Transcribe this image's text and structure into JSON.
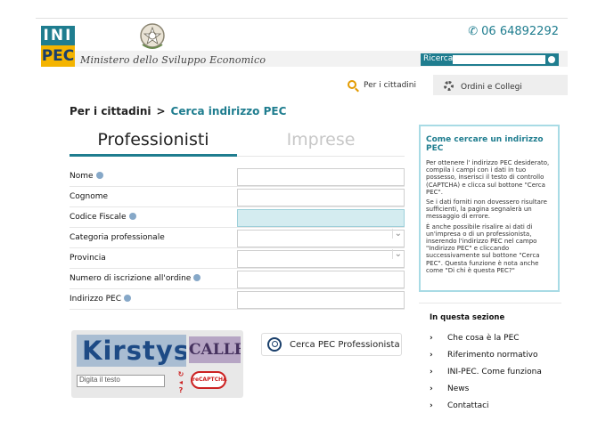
{
  "header": {
    "logo_top": "INI",
    "logo_bottom": "PEC",
    "ministry": "Ministero dello Sviluppo Economico",
    "phone": "06 64892292",
    "search_label": "Ricerca",
    "search_placeholder": ""
  },
  "nav": {
    "citizens": "Per i cittadini",
    "orders": "Ordini e Collegi"
  },
  "breadcrumb": {
    "root": "Per i cittadini",
    "sep": ">",
    "current": "Cerca indirizzo PEC"
  },
  "tabs": [
    "Professionisti",
    "Imprese"
  ],
  "form": {
    "fields": [
      {
        "label": "Nome",
        "info": true,
        "type": "text",
        "value": ""
      },
      {
        "label": "Cognome",
        "info": false,
        "type": "text",
        "value": ""
      },
      {
        "label": "Codice Fiscale",
        "info": true,
        "type": "text",
        "value": ""
      },
      {
        "label": "Categoria professionale",
        "info": false,
        "type": "select",
        "value": ""
      },
      {
        "label": "Provincia",
        "info": false,
        "type": "select",
        "value": ""
      },
      {
        "label": "Numero di iscrizione all'ordine",
        "info": true,
        "type": "text",
        "value": ""
      },
      {
        "label": "Indirizzo PEC",
        "info": true,
        "type": "text",
        "value": ""
      }
    ]
  },
  "captcha": {
    "word1": "Kirstys",
    "word2": "CALLE",
    "placeholder": "Digita il testo",
    "brand": "reCAPTCHA"
  },
  "search_button": "Cerca PEC Professionista",
  "help": {
    "title": "Come cercare un indirizzo PEC",
    "paragraphs": [
      "Per ottenere l' indirizzo PEC desiderato, compila i campi con i dati in tuo possesso, inserisci il testo di controllo (CAPTCHA) e clicca sul bottone \"Cerca PEC\".",
      "Se i dati forniti non dovessero risultare sufficienti, la pagina segnalerà un messaggio di errore.",
      "È anche possibile risalire ai dati di un'impresa o di un professionista, inserendo l'indirizzo PEC nel campo \"Indirizzo PEC\" e cliccando successivamente sul bottone \"Cerca PEC\". Questa funzione è nota anche come \"Di chi è questa PEC?\""
    ]
  },
  "section": {
    "title": "In questa sezione",
    "items": [
      "Che cosa è la PEC",
      "Riferimento normativo",
      "INI-PEC. Come funziona",
      "News",
      "Contattaci"
    ]
  },
  "colors": {
    "accent": "#1f7d8f",
    "logo_yellow": "#f4b400"
  }
}
